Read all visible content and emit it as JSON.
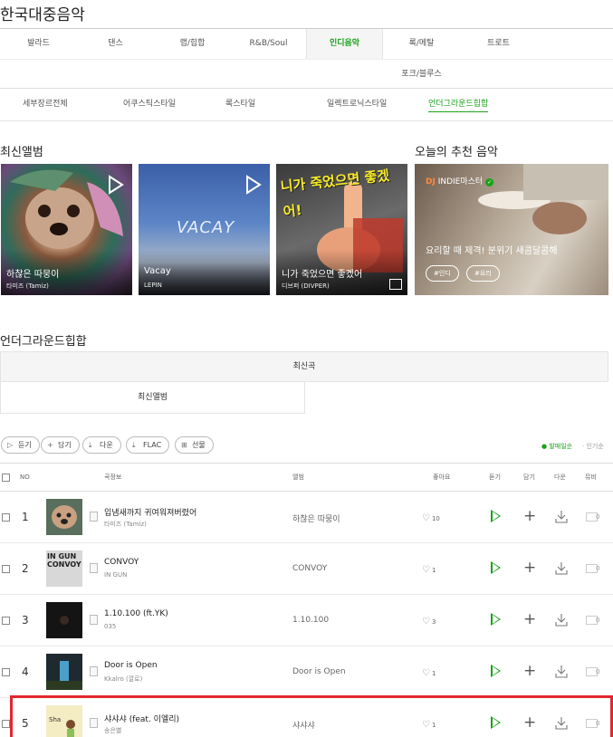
{
  "page_title": "한국대중음악",
  "genres": {
    "row1": [
      "발라드",
      "댄스",
      "랩/힙합",
      "R&B/Soul",
      "인디음악",
      "록/메탈",
      "트로트"
    ],
    "row2": [
      "포크/블루스"
    ],
    "active": "인디음악"
  },
  "subgenres": [
    "세부장르전체",
    "어쿠스틱스타일",
    "록스타일",
    "일렉트로닉스타일",
    "언더그라운드힙합"
  ],
  "latest_albums": {
    "title": "최신앨범",
    "items": [
      {
        "name": "하찮은 따뭉이",
        "artist": "타미즈 (Tamiz)"
      },
      {
        "name": "Vacay",
        "artist": "LEPIN",
        "cover_text": "VACAY"
      },
      {
        "name": "니가 죽었으면 좋겠어",
        "artist": "디브퍼 (DIVPER)",
        "cover_text": "니가 죽었으면 좋겠어!"
      }
    ]
  },
  "recommend": {
    "title": "오늘의 추천 음악",
    "dj_label": "DJ",
    "dj_name": "INDIE마스터",
    "headline": "요리할 때 제격! 분위기 새콤달콤해",
    "tags": [
      "#인디",
      "#요리"
    ]
  },
  "underground": {
    "title": "언더그라운드힙합",
    "tabs": [
      "최신곡",
      "최신앨범"
    ]
  },
  "controls": {
    "buttons": [
      "듣기",
      "담기",
      "다운",
      "FLAC",
      "선물"
    ],
    "sort": [
      "발매일순",
      "인기순"
    ]
  },
  "table": {
    "headers": [
      "NO",
      "곡정보",
      "앨범",
      "좋아요",
      "듣기",
      "담기",
      "다운",
      "뮤비"
    ],
    "rows": [
      {
        "no": "1",
        "title": "입냄새까지 귀여워져버렸어",
        "artist": "타미즈 (Tamiz)",
        "album": "하찮은 따뭉이",
        "likes": "10",
        "mv": "0",
        "cover_text": ""
      },
      {
        "no": "2",
        "title": "CONVOY",
        "artist": "IN GUN",
        "album": "CONVOY",
        "likes": "1",
        "mv": "0",
        "cover_text": "IN GUN CONVOY"
      },
      {
        "no": "3",
        "title": "1.10.100 (ft.YK)",
        "artist": "035",
        "album": "1.10.100",
        "likes": "3",
        "mv": "0",
        "cover_text": ""
      },
      {
        "no": "4",
        "title": "Door is Open",
        "artist": "Kkalro (깔로)",
        "album": "Door is Open",
        "likes": "1",
        "mv": "0",
        "cover_text": ""
      },
      {
        "no": "5",
        "title": "샤샤샤 (feat. 이엘리)",
        "artist": "송은별",
        "album": "샤샤샤",
        "likes": "1",
        "mv": "0",
        "cover_text": "Sha"
      }
    ]
  },
  "colors": {
    "accent": "#1aa31a",
    "highlight": "#e3272d"
  }
}
